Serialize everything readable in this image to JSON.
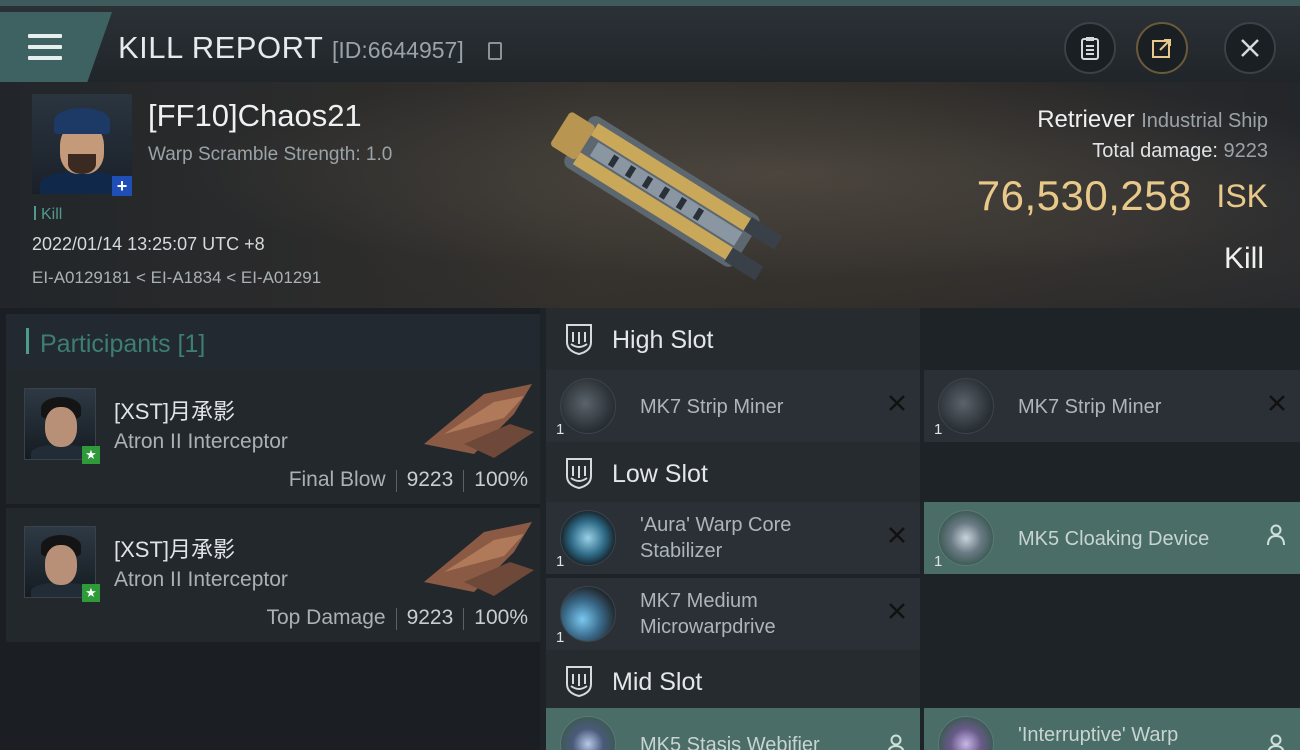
{
  "header": {
    "title": "KILL REPORT",
    "id_text": "[ID:6644957]"
  },
  "victim": {
    "name": "[FF10]Chaos21",
    "warp_scramble": "Warp Scramble Strength: 1.0",
    "kill_tag": "Kill",
    "timestamp": "2022/01/14 13:25:07 UTC +8",
    "route": "EI-A0129181 < EI-A1834 < EI-A01291",
    "ship_name": "Retriever",
    "ship_class": "Industrial Ship",
    "total_damage_label": "Total damage:",
    "total_damage_value": "9223",
    "isk_value": "76,530,258",
    "isk_unit": "ISK",
    "kill_type": "Kill"
  },
  "participants": {
    "title": "Participants [1]",
    "rows": [
      {
        "name": "[XST]月承影",
        "ship": "Atron II Interceptor",
        "label": "Final Blow",
        "damage": "9223",
        "percent": "100%"
      },
      {
        "name": "[XST]月承影",
        "ship": "Atron II Interceptor",
        "label": "Top Damage",
        "damage": "9223",
        "percent": "100%"
      }
    ]
  },
  "fitting": {
    "high_slot": {
      "title": "High Slot",
      "modules": [
        {
          "name": "MK7 Strip Miner",
          "qty": "1"
        },
        {
          "name": "MK7 Strip Miner",
          "qty": "1"
        }
      ]
    },
    "low_slot": {
      "title": "Low Slot",
      "modules": [
        {
          "name_line1": "'Aura' Warp Core",
          "name_line2": "Stabilizer",
          "qty": "1"
        },
        {
          "name": "MK5 Cloaking Device",
          "qty": "1"
        },
        {
          "name_line1": "MK7 Medium",
          "name_line2": "Microwarpdrive",
          "qty": "1"
        }
      ]
    },
    "mid_slot": {
      "title": "Mid Slot",
      "modules": [
        {
          "name": "MK5 Stasis Webifier"
        },
        {
          "name": "'Interruptive' Warp"
        }
      ]
    }
  },
  "colors": {
    "accent_teal": "#4f9a8e",
    "isk_gold": "#e9c98a",
    "rigged_bg": "#4a6d67"
  }
}
